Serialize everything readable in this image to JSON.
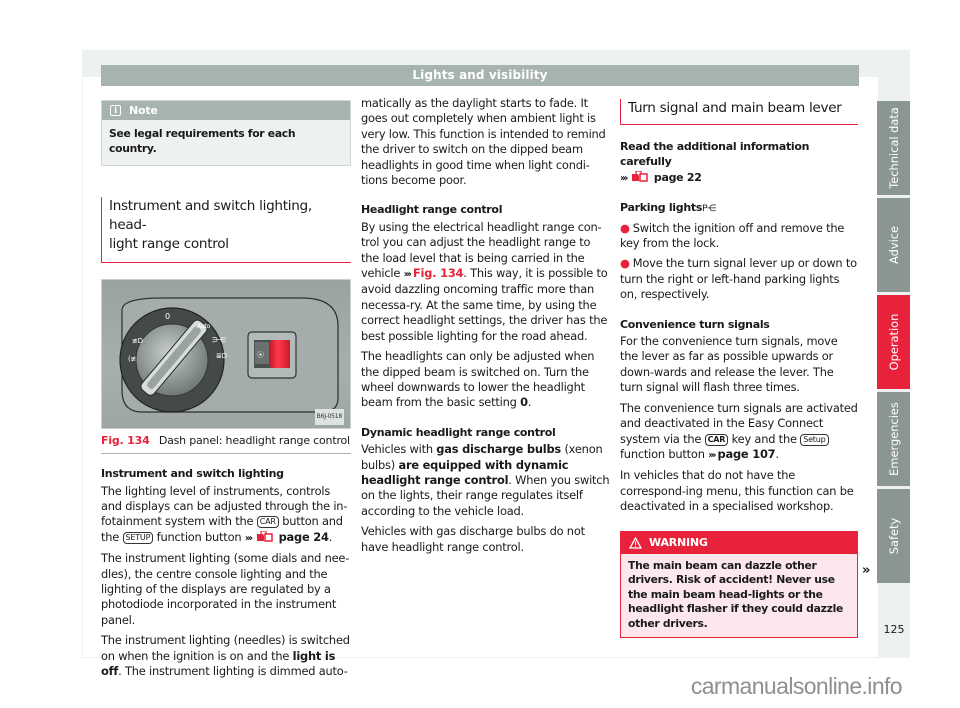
{
  "header": {
    "title": "Lights and visibility"
  },
  "note": {
    "icon": "info-icon",
    "title": "Note",
    "body": "See legal requirements for each country."
  },
  "section1": {
    "title_line1": "Instrument and switch lighting, head-",
    "title_line2": "light range control",
    "figure": {
      "code": "B6J-0518",
      "label": "Fig. 134",
      "caption": "Dash panel: headlight range control",
      "dial_labels": [
        "0",
        "Auto"
      ]
    },
    "instrument_heading": "Instrument and switch lighting",
    "p1_a": "The lighting level of instruments, controls and displays can be adjusted through the in-fotainment system with the",
    "key_car": "CAR",
    "p1_b": "button and the",
    "key_setup": "SETUP",
    "p1_c": "function button",
    "p1_arrows": "›››",
    "p1_page": "page 24",
    "p1_end": ".",
    "p2": "The instrument lighting (some dials and nee-dles), the centre console lighting and the lighting of the displays are regulated by a photodiode incorporated in the instrument panel.",
    "p3_a": "The instrument lighting (needles) is switched on when the ignition is on and the",
    "p3_bold": "light is off",
    "p3_b": ". The instrument lighting is dimmed auto-"
  },
  "column2": {
    "p_cont": "matically as the daylight starts to fade. It goes out completely when ambient light is very low. This function is intended to remind the driver to switch on the dipped beam headlights in good time when light condi-tions become poor.",
    "hrc_heading": "Headlight range control",
    "hrc_p1_a": "By using the electrical headlight range con-trol you can adjust the headlight range to the load level that is being carried in the vehicle",
    "hrc_arrows": "›››",
    "hrc_fig": "Fig. 134",
    "hrc_p1_b": ". This way, it is possible to avoid dazzling oncoming traffic more than necessa-ry. At the same time, by using the correct headlight settings, the driver has the best possible lighting for the road ahead.",
    "hrc_p2_a": "The headlights can only be adjusted when the dipped beam is switched on. Turn the wheel downwards to lower the headlight beam from the basic setting",
    "hrc_p2_bold": "0",
    "hrc_p2_b": ".",
    "dyn_heading": "Dynamic headlight range control",
    "dyn_p1_a": "Vehicles with",
    "dyn_p1_bold1": "gas discharge bulbs",
    "dyn_p1_b": "(xenon bulbs)",
    "dyn_p1_bold2": "are equipped with dynamic headlight range control",
    "dyn_p1_c": ". When you switch on the lights, their range regulates itself according to the vehicle load.",
    "dyn_p2": "Vehicles with gas discharge bulbs do not have headlight range control."
  },
  "section2": {
    "title": "Turn signal and main beam lever",
    "read_info": "Read the additional information carefully",
    "read_arrows": "›››",
    "read_page": "page 22",
    "parking_heading": "Parking lights",
    "parking_symbol": "P⋲",
    "bullets": [
      "Switch the ignition off and remove the key from the lock.",
      "Move the turn signal lever up or down to turn the right or left-hand parking lights on, respectively."
    ],
    "conv_heading": "Convenience turn signals",
    "conv_p1": "For the convenience turn signals, move the lever as far as possible upwards or down-wards and release the lever. The turn signal will flash three times.",
    "conv_p2_a": "The convenience turn signals are activated and deactivated in the Easy Connect system via the",
    "key_car": "CAR",
    "conv_p2_b": "key and the",
    "key_setup": "Setup",
    "conv_p2_c": "function button",
    "conv_arrows": "›››",
    "conv_page": "page 107",
    "conv_end": ".",
    "conv_p3": "In vehicles that do not have the correspond-ing menu, this function can be deactivated in a specialised workshop.",
    "warning": {
      "icon": "warning-triangle-icon",
      "title": "WARNING",
      "body": "The main beam can dazzle other drivers. Risk of accident! Never use the main beam head-lights or the headlight flasher if they could dazzle other drivers."
    },
    "continue_mark": "»"
  },
  "tabs": [
    {
      "label": "Technical data",
      "active": false
    },
    {
      "label": "Advice",
      "active": false
    },
    {
      "label": "Operation",
      "active": true
    },
    {
      "label": "Emergencies",
      "active": false
    },
    {
      "label": "Safety",
      "active": false
    }
  ],
  "page_number": "125",
  "watermark": "carmanualsonline.info",
  "colors": {
    "accent": "#e8223a",
    "header_gray": "#a6b3b1",
    "tab_gray": "#8a9694",
    "warning_bg": "#fce8ec"
  }
}
